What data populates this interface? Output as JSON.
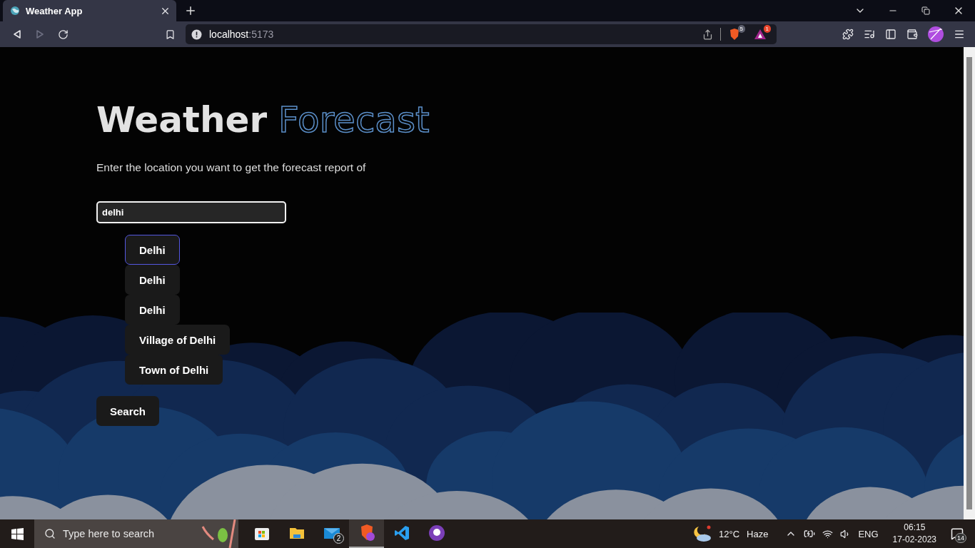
{
  "browser": {
    "tab": {
      "title": "Weather App"
    },
    "address": {
      "host": "localhost",
      "port": ":5173"
    },
    "shields_count": "5",
    "rewards_count": "1"
  },
  "page": {
    "title_solid": "Weather",
    "title_outline": "Forecast",
    "subtitle": "Enter the location you want to get the forecast report of",
    "search": {
      "value": "delhi"
    },
    "suggestions": [
      {
        "label": "Delhi",
        "selected": true
      },
      {
        "label": "Delhi",
        "selected": false
      },
      {
        "label": "Delhi",
        "selected": false
      },
      {
        "label": "Village of Delhi",
        "selected": false
      },
      {
        "label": "Town of Delhi",
        "selected": false
      }
    ],
    "button": "Search"
  },
  "taskbar": {
    "search_placeholder": "Type here to search",
    "mail_count": "2",
    "weather": {
      "temp": "12°C",
      "condition": "Haze"
    },
    "language": "ENG",
    "time": "06:15",
    "date": "17-02-2023",
    "notifications": "14"
  }
}
